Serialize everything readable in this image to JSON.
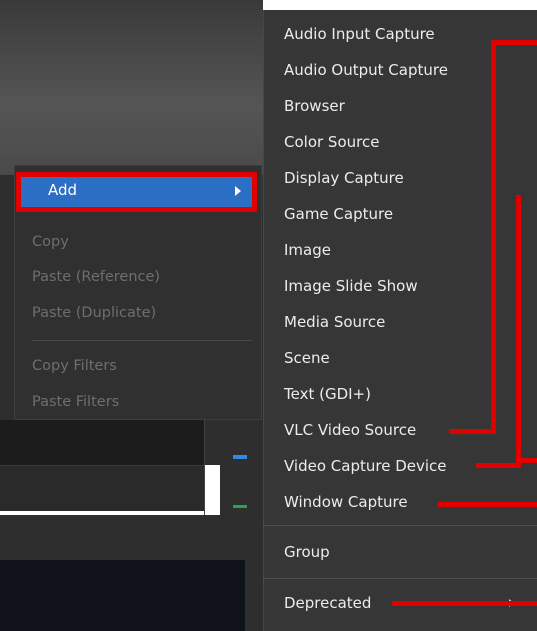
{
  "context_menu": {
    "add_label": "Add",
    "items": [
      {
        "label": "Copy",
        "enabled": false
      },
      {
        "label": "Paste (Reference)",
        "enabled": false
      },
      {
        "label": "Paste (Duplicate)",
        "enabled": false
      },
      {
        "label": "Copy Filters",
        "enabled": false
      },
      {
        "label": "Paste Filters",
        "enabled": false
      }
    ]
  },
  "add_submenu": {
    "items": [
      {
        "label": "Audio Input Capture"
      },
      {
        "label": "Audio Output Capture"
      },
      {
        "label": "Browser"
      },
      {
        "label": "Color Source"
      },
      {
        "label": "Display Capture"
      },
      {
        "label": "Game Capture"
      },
      {
        "label": "Image"
      },
      {
        "label": "Image Slide Show"
      },
      {
        "label": "Media Source"
      },
      {
        "label": "Scene"
      },
      {
        "label": "Text (GDI+)"
      },
      {
        "label": "VLC Video Source"
      },
      {
        "label": "Video Capture Device"
      },
      {
        "label": "Window Capture"
      },
      {
        "label": "Group"
      },
      {
        "label": "Deprecated"
      }
    ]
  },
  "colors": {
    "highlight": "#2a6fc4",
    "annotation": "#e00000",
    "menu_bg": "#363636"
  },
  "icons": {
    "submenu_arrow": "chevron-right-icon"
  }
}
